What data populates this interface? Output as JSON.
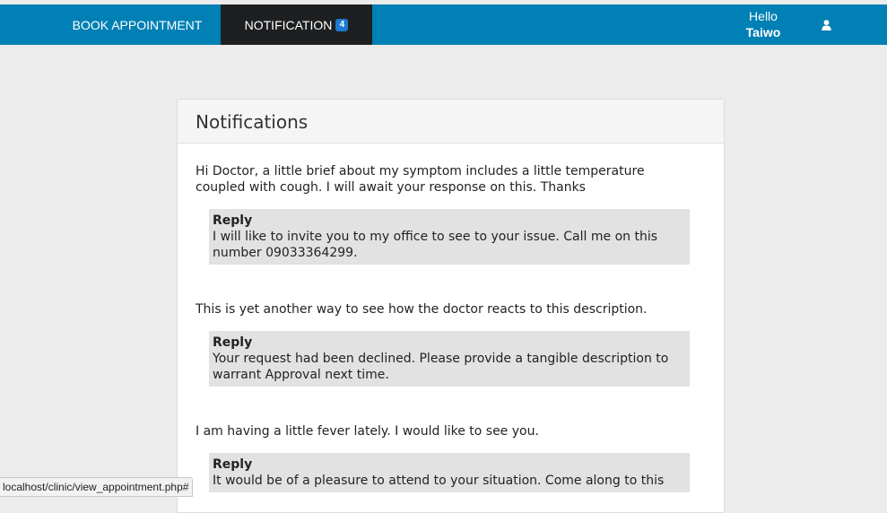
{
  "navbar": {
    "book_label": "BOOK APPOINTMENT",
    "notification_label": "NOTIFICATION",
    "notification_count": "4",
    "greeting": "Hello",
    "user_name": "Taiwo",
    "user_icon": "user-icon",
    "bar_color": "#0080b5",
    "active_tab_color": "#1d1f21"
  },
  "panel": {
    "title": "Notifications",
    "items": [
      {
        "message": "Hi Doctor, a little brief about my symptom includes a little temperature coupled with cough. I will await your response on this. Thanks",
        "reply_label": "Reply",
        "reply_text": "I will like to invite you to my office to see to your issue. Call me on this number 09033364299."
      },
      {
        "message": "This is yet another way to see how the doctor reacts to this description.",
        "reply_label": "Reply",
        "reply_text": "Your request had been declined. Please provide a tangible description to warrant Approval next time."
      },
      {
        "message": "I am having a little fever lately. I would like to see you.",
        "reply_label": "Reply",
        "reply_text": "It would be of a pleasure to attend to your situation. Come along to this"
      }
    ]
  },
  "statusbar": {
    "url": "localhost/clinic/view_appointment.php#"
  }
}
